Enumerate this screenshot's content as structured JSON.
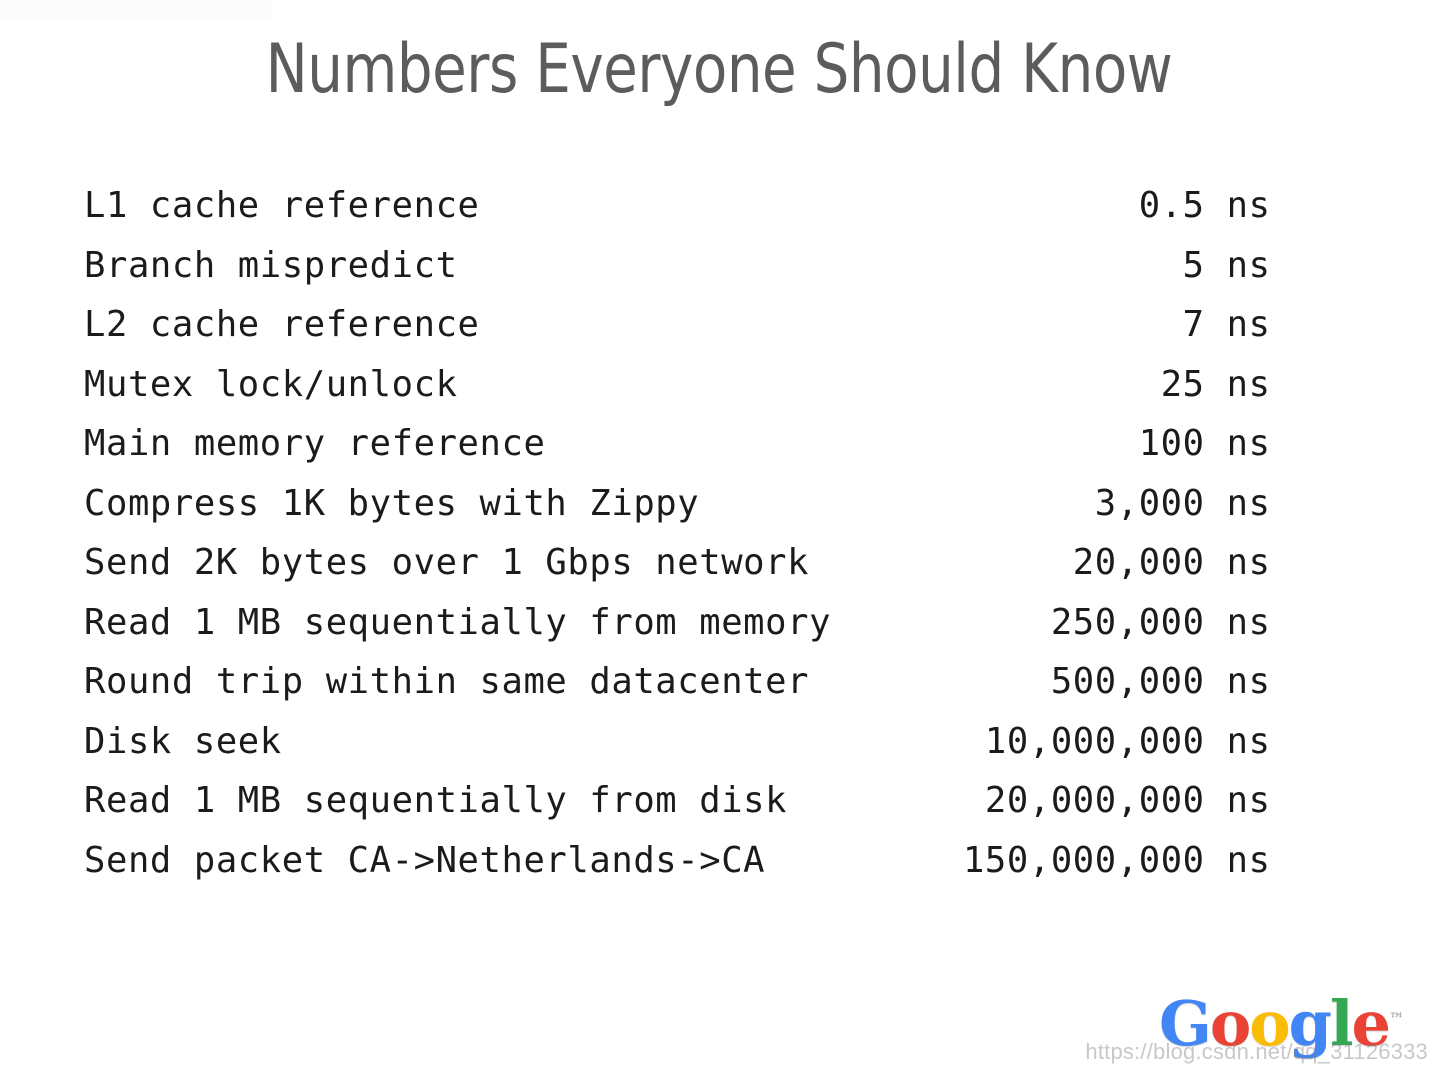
{
  "slide": {
    "title": "Numbers Everyone Should Know",
    "background_color": "#ffffff",
    "title_color": "#5c5c5c",
    "text_color": "#1b1b1b"
  },
  "table": {
    "unit": "ns",
    "label_column_width": 40,
    "value_column_width": 11,
    "rows": [
      {
        "label": "L1 cache reference",
        "value": "0.5",
        "unit": "ns",
        "value_ns": 0.5
      },
      {
        "label": "Branch mispredict",
        "value": "5",
        "unit": "ns",
        "value_ns": 5
      },
      {
        "label": "L2 cache reference",
        "value": "7",
        "unit": "ns",
        "value_ns": 7
      },
      {
        "label": "Mutex lock/unlock",
        "value": "25",
        "unit": "ns",
        "value_ns": 25
      },
      {
        "label": "Main memory reference",
        "value": "100",
        "unit": "ns",
        "value_ns": 100
      },
      {
        "label": "Compress 1K bytes with Zippy",
        "value": "3,000",
        "unit": "ns",
        "value_ns": 3000
      },
      {
        "label": "Send 2K bytes over 1 Gbps network",
        "value": "20,000",
        "unit": "ns",
        "value_ns": 20000
      },
      {
        "label": "Read 1 MB sequentially from memory",
        "value": "250,000",
        "unit": "ns",
        "value_ns": 250000
      },
      {
        "label": "Round trip within same datacenter",
        "value": "500,000",
        "unit": "ns",
        "value_ns": 500000
      },
      {
        "label": "Disk seek",
        "value": "10,000,000",
        "unit": "ns",
        "value_ns": 10000000
      },
      {
        "label": "Read 1 MB sequentially from disk",
        "value": "20,000,000",
        "unit": "ns",
        "value_ns": 20000000
      },
      {
        "label": "Send packet CA->Netherlands->CA",
        "value": "150,000,000",
        "unit": "ns",
        "value_ns": 150000000
      }
    ]
  },
  "logo": {
    "letters": [
      {
        "char": "G",
        "color": "#4285F4"
      },
      {
        "char": "o",
        "color": "#EA4335"
      },
      {
        "char": "o",
        "color": "#FBBC05"
      },
      {
        "char": "g",
        "color": "#4285F4"
      },
      {
        "char": "l",
        "color": "#34A853"
      },
      {
        "char": "e",
        "color": "#EA4335"
      }
    ],
    "text": "Google",
    "trademark": "™"
  },
  "watermark": {
    "text": "https://blog.csdn.net/qq_31126333"
  }
}
